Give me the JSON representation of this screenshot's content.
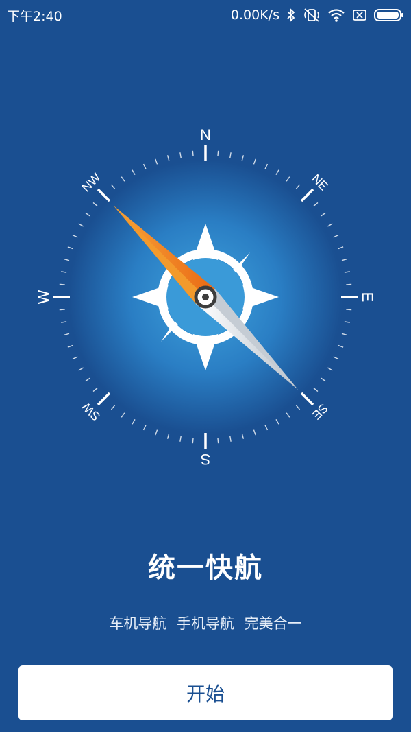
{
  "status_bar": {
    "time": "下午2:40",
    "net_speed": "0.00K/s",
    "icons": [
      "bluetooth-icon",
      "silent-icon",
      "wifi-icon",
      "sim-off-icon",
      "battery-icon"
    ]
  },
  "compass": {
    "directions": {
      "n": "N",
      "ne": "NE",
      "e": "E",
      "se": "SE",
      "s": "S",
      "sw": "SW",
      "w": "W",
      "nw": "NW"
    },
    "colors": {
      "background": "#1a4f91",
      "needle_orange": "#f07d1f",
      "needle_silver": "#dfe3e8",
      "face_center": "#3fa2dc"
    }
  },
  "title": "统一快航",
  "subtitle": "车机导航 手机导航 完美合一",
  "start_button": "开始"
}
